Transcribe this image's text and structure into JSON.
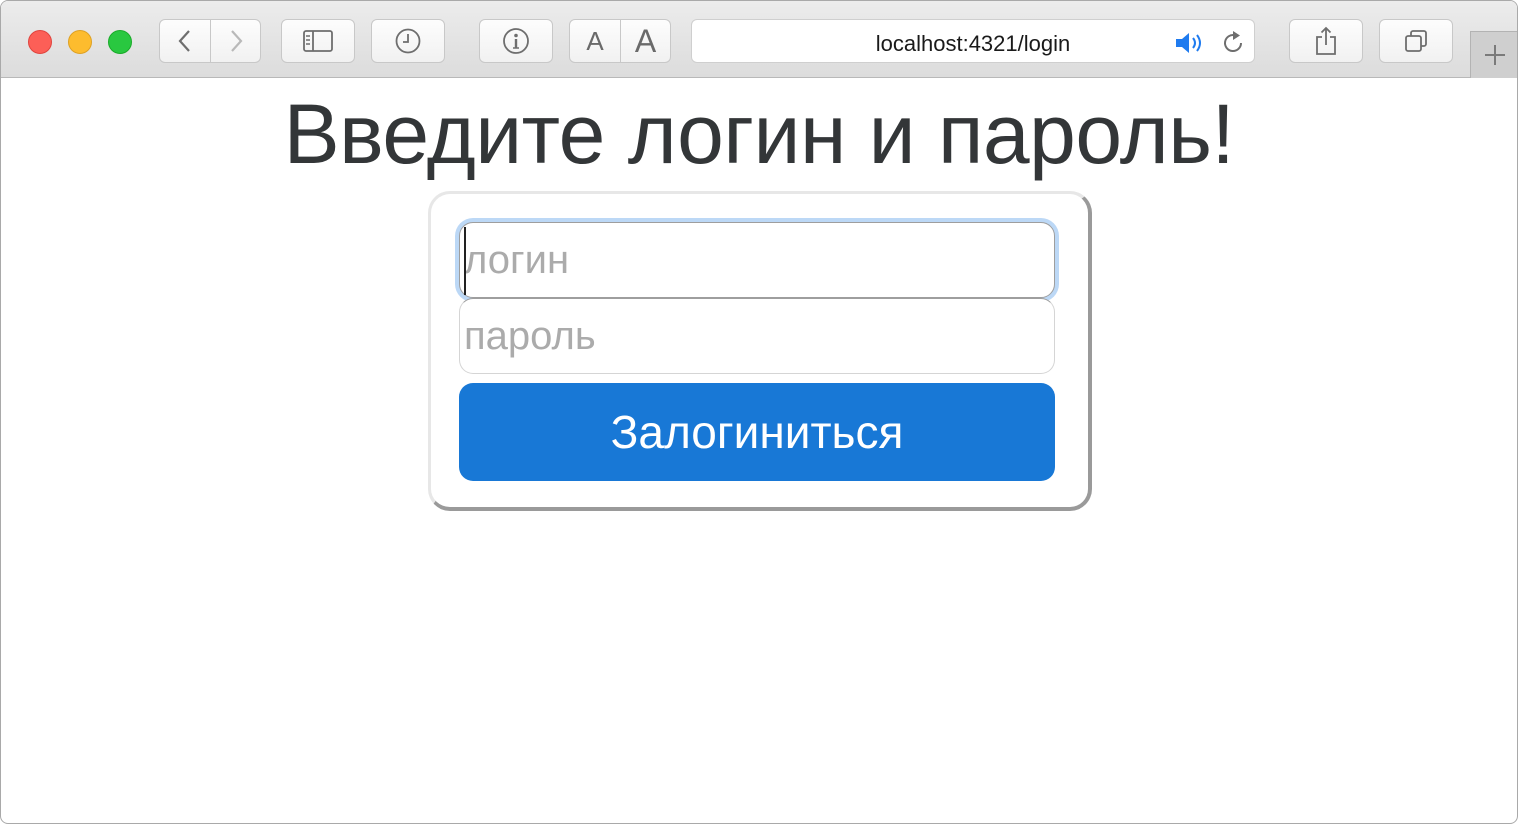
{
  "browser": {
    "url": "localhost:4321/login",
    "font_small_label": "A",
    "font_large_label": "A",
    "accent_color": "#1878d6",
    "icons": [
      "back-chevron-icon",
      "forward-chevron-icon",
      "sidebar-icon",
      "history-clock-icon",
      "info-icon",
      "speaker-icon",
      "reload-icon",
      "share-icon",
      "tabs-overview-icon",
      "plus-icon"
    ]
  },
  "page": {
    "heading": "Введите логин и пароль!",
    "login_placeholder": "логин",
    "login_value": "",
    "password_placeholder": "пароль",
    "password_value": "",
    "submit_label": "Залогиниться",
    "submit_color": "#1878d6"
  }
}
